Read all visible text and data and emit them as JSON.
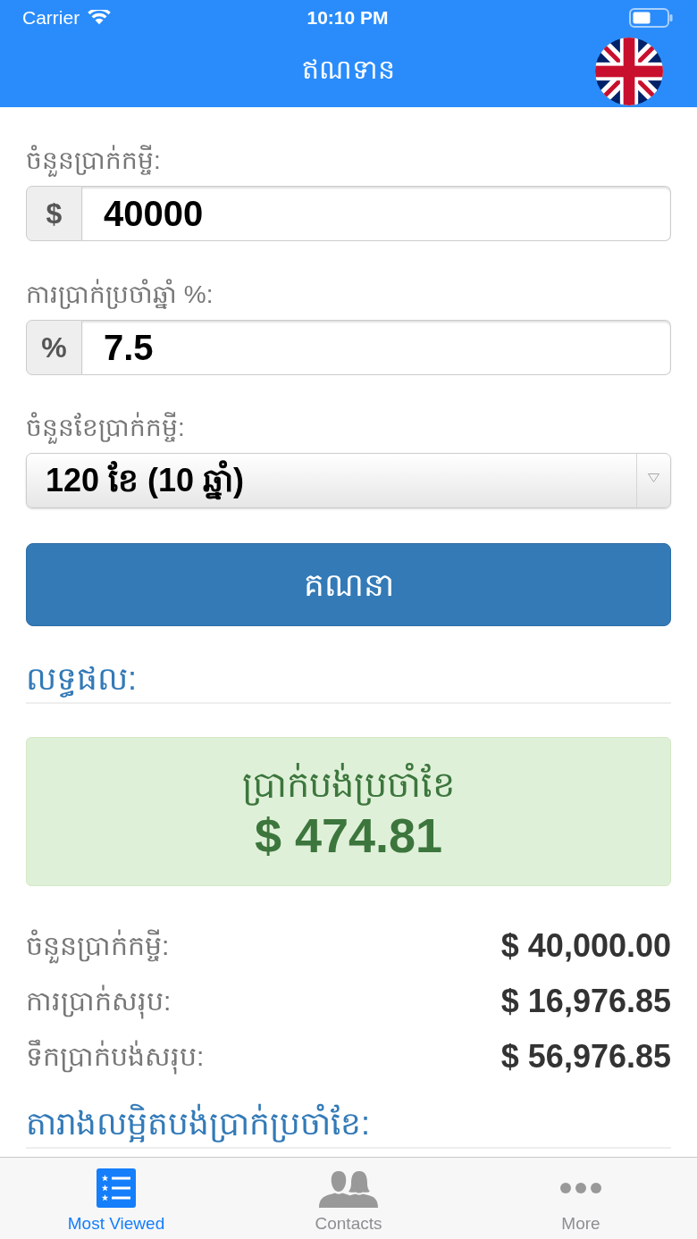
{
  "status_bar": {
    "carrier": "Carrier",
    "time": "10:10 PM"
  },
  "nav_bar": {
    "title": "ឥណទាន"
  },
  "form": {
    "fields": [
      {
        "kind": "input",
        "label": "ចំនួនប្រាក់កម្ចី:",
        "addon": "$",
        "value": "40000"
      },
      {
        "kind": "input",
        "label": "ការប្រាក់ប្រចាំឆ្នាំ %:",
        "addon": "%",
        "value": "7.5"
      },
      {
        "kind": "select",
        "label": "ចំនួនខែប្រាក់កម្ចី:",
        "value": "120 ខែ (10 ឆ្នាំ)"
      }
    ],
    "button": "គណនា"
  },
  "results": {
    "heading": "លទ្ធផល:",
    "monthly_payment": {
      "label": "ប្រាក់បង់ប្រចាំខែ",
      "value": "$ 474.81"
    },
    "summary": [
      {
        "label": "ចំនួនប្រាក់កម្ចី:",
        "value": "$ 40,000.00"
      },
      {
        "label": "ការប្រាក់សរុប:",
        "value": "$ 16,976.85"
      },
      {
        "label": "ទឹកប្រាក់បង់សរុប:",
        "value": "$ 56,976.85"
      }
    ]
  },
  "schedule": {
    "heading": "តារាងលម្អិតបង់ប្រាក់ប្រចាំខែ:"
  },
  "tab_bar": {
    "items": [
      {
        "kind": "list",
        "label": "Most Viewed",
        "selected": true
      },
      {
        "kind": "contacts",
        "label": "Contacts",
        "selected": false
      },
      {
        "kind": "more",
        "label": "More",
        "selected": false
      }
    ]
  }
}
